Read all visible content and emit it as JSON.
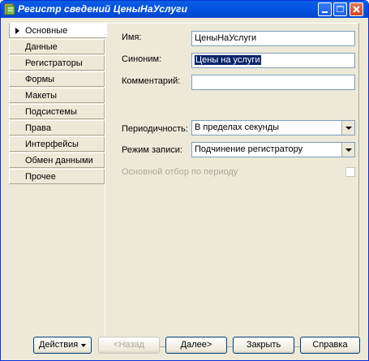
{
  "window": {
    "title": "Регистр сведений ЦеныНаУслуги",
    "accent_color": "#0454e4",
    "icons": [
      "app-icon",
      "minimize-icon",
      "maximize-icon",
      "close-icon"
    ]
  },
  "sidebar": {
    "items": [
      {
        "label": "Основные",
        "active": true
      },
      {
        "label": "Данные"
      },
      {
        "label": "Регистраторы"
      },
      {
        "label": "Формы"
      },
      {
        "label": "Макеты"
      },
      {
        "label": "Подсистемы"
      },
      {
        "label": "Права"
      },
      {
        "label": "Интерфейсы"
      },
      {
        "label": "Обмен данными"
      },
      {
        "label": "Прочее"
      }
    ]
  },
  "form": {
    "name_label": "Имя:",
    "name_value": "ЦеныНаУслуги",
    "synonym_label": "Синоним:",
    "synonym_value": "Цены на услуги",
    "comment_label": "Комментарий:",
    "comment_value": "",
    "periodicity_label": "Периодичность:",
    "periodicity_value": "В пределах секунды",
    "write_mode_label": "Режим записи:",
    "write_mode_value": "Подчинение регистратору",
    "period_filter_label": "Основной отбор по периоду",
    "period_filter_checked": false
  },
  "footer": {
    "actions_label": "Действия",
    "back_label": "<Назад",
    "next_label": "Далее>",
    "close_label": "Закрыть",
    "help_label": "Справка"
  }
}
